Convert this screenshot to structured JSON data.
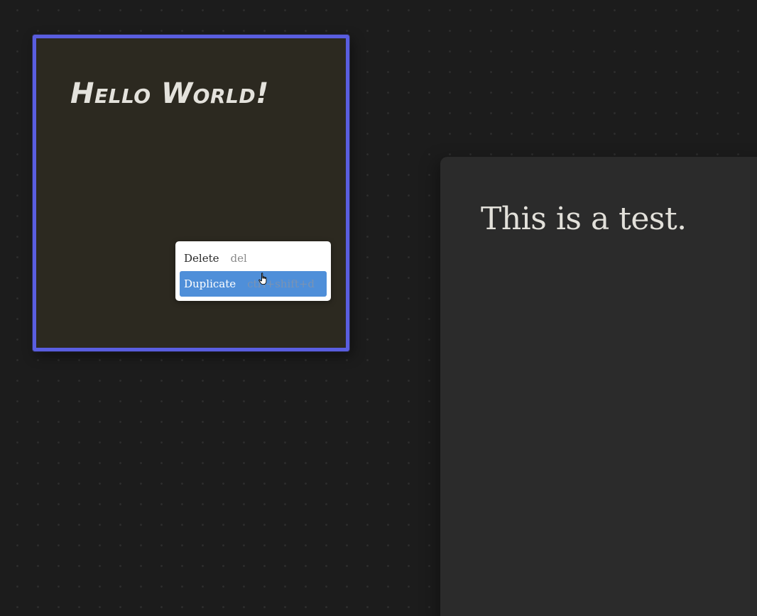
{
  "note": {
    "title": "Hello World!"
  },
  "document": {
    "text": "This is a test."
  },
  "context_menu": {
    "items": [
      {
        "label": "Delete",
        "shortcut": "del",
        "active": false
      },
      {
        "label": "Duplicate",
        "shortcut": "ctrl+shift+d",
        "active": true
      }
    ]
  },
  "colors": {
    "background": "#1c1c1c",
    "note_background": "#2c2920",
    "selection_border": "#5a5ee0",
    "panel_background": "#2b2b2b",
    "menu_highlight": "#4f8fd9"
  },
  "icons": {
    "cursor": "hand-pointer-icon"
  }
}
